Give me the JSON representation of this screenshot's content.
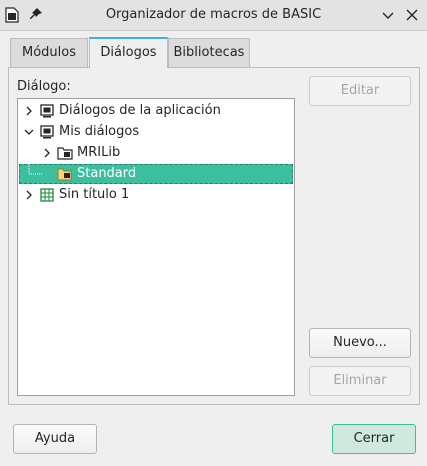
{
  "window": {
    "title": "Organizador de macros de BASIC",
    "icons": [
      "app-document-icon",
      "pin-icon",
      "chevron-down-icon",
      "close-icon"
    ]
  },
  "tabs": [
    {
      "label": "Módulos",
      "active": false
    },
    {
      "label": "Diálogos",
      "active": true
    },
    {
      "label": "Bibliotecas",
      "active": false
    }
  ],
  "panel": {
    "label": "Diálogo:",
    "tree": [
      {
        "label": "Diálogos de la aplicación",
        "expander": "collapsed",
        "icon": "application-library-icon",
        "selected": false
      },
      {
        "label": "Mis diálogos",
        "expander": "expanded",
        "icon": "my-library-icon",
        "selected": false
      },
      {
        "label": "MRILib",
        "expander": "collapsed",
        "icon": "library-folder-icon",
        "selected": false
      },
      {
        "label": "Standard",
        "expander": "none",
        "icon": "open-folder-icon",
        "selected": true
      },
      {
        "label": "Sin título 1",
        "expander": "collapsed",
        "icon": "spreadsheet-document-icon",
        "selected": false
      }
    ]
  },
  "buttons": {
    "edit": "Editar",
    "new": "Nuevo...",
    "delete": "Eliminar",
    "help": "Ayuda",
    "close": "Cerrar"
  },
  "colors": {
    "accent": "#3bbf9f",
    "tab_accent": "#3daee9"
  }
}
